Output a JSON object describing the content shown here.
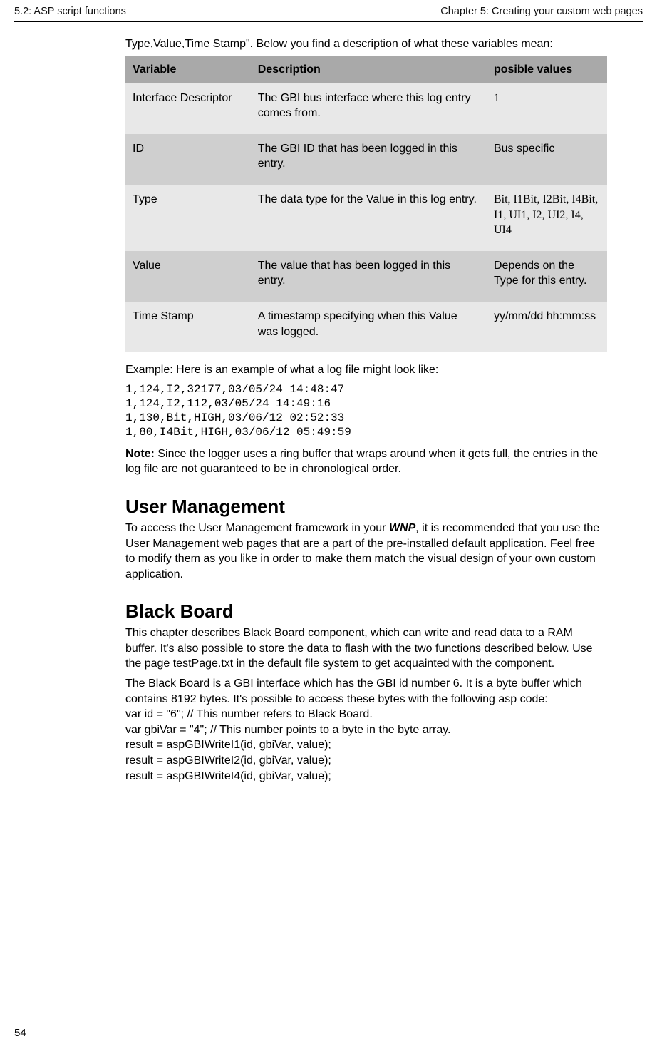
{
  "header": {
    "left": "5.2: ASP script functions",
    "right": "Chapter 5: Creating your custom web pages"
  },
  "intro": "Type,Value,Time Stamp\". Below you find a description of what these variables mean:",
  "table": {
    "head": {
      "c1": "Variable",
      "c2": "Description",
      "c3": "posible values"
    },
    "rows": [
      {
        "c1": "Interface Descriptor",
        "c2": "The GBI bus interface where this log entry comes from.",
        "c3": "1"
      },
      {
        "c1": "ID",
        "c2": "The GBI ID that has been logged in this entry.",
        "c3": "Bus specific"
      },
      {
        "c1": "Type",
        "c2": "The data type for the Value in this log entry.",
        "c3": "Bit, I1Bit, I2Bit, I4Bit, I1, UI1, I2, UI2, I4, UI4"
      },
      {
        "c1": "Value",
        "c2": "The value that has been logged in this entry.",
        "c3": "Depends on the Type for this entry."
      },
      {
        "c1": "Time Stamp",
        "c2": "A timestamp specifying when this Value was logged.",
        "c3": "yy/mm/dd hh:mm:ss"
      }
    ]
  },
  "example_label": "Example: Here is an example of what a log file might look like:",
  "example_code": "1,124,I2,32177,03/05/24 14:48:47\n1,124,I2,112,03/05/24 14:49:16\n1,130,Bit,HIGH,03/06/12 02:52:33\n1,80,I4Bit,HIGH,03/06/12 05:49:59",
  "note": {
    "label": "Note:",
    "text": " Since the logger uses a ring buffer that wraps around when it gets full, the entries in the log file are not guaranteed to be in chronological order."
  },
  "user_mgmt": {
    "title": "User Management",
    "p1a": "To access the User Management framework in your ",
    "p1b": "WNP",
    "p1c": ", it is recommended that you use the User Management web pages that are a part of the pre-installed default application. Feel free to modify them as you like in order to make them match the visual design of your own custom application."
  },
  "black_board": {
    "title": "Black Board",
    "p1": "This chapter describes Black Board component, which can write and read data to a RAM buffer. It's also possible to store the data to flash with the two functions described below. Use the page testPage.txt in the default file system to get acquainted with the component.",
    "p2": "The Black Board is a GBI interface which has the GBI id number 6. It is a byte buffer which contains 8192 bytes. It's possible to access these bytes with the following asp code:",
    "l1": "var id = \"6\";    // This number refers to Black Board.",
    "l2": "var gbiVar = \"4\"; // This number points to a byte in the byte array.",
    "l3": "result = aspGBIWriteI1(id, gbiVar, value);",
    "l4": "result = aspGBIWriteI2(id, gbiVar, value);",
    "l5": "result = aspGBIWriteI4(id, gbiVar, value);"
  },
  "page_number": "54"
}
